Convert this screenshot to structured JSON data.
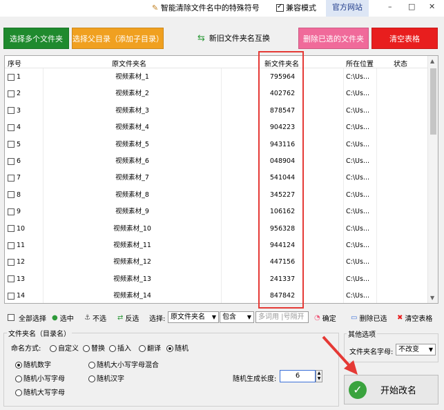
{
  "titlebar": {
    "tool_label": "智能清除文件名中的特殊符号",
    "compat_label": "兼容模式",
    "site_link": "官方网站",
    "minimize": "–",
    "maximize": "□",
    "close": "✕"
  },
  "toolbar": {
    "select_multi": "选择多个文件夹",
    "select_parent": "选择父目录（添加子目录）",
    "swap": "新旧文件夹名互换",
    "delete_selected": "删除已选的文件夹",
    "clear_table": "清空表格",
    "colors": {
      "green": "#1f8a2e",
      "orange": "#f0a020",
      "pink": "#f06a9a",
      "red": "#e81e1e"
    }
  },
  "table": {
    "headers": {
      "index": "序号",
      "original": "原文件夹名",
      "new": "新文件夹名",
      "location": "所在位置",
      "status": "状态"
    },
    "rows": [
      {
        "index": "1",
        "original": "视频素材_1",
        "new": "795964",
        "location": "C:\\Us...",
        "status": ""
      },
      {
        "index": "2",
        "original": "视频素材_2",
        "new": "402762",
        "location": "C:\\Us...",
        "status": ""
      },
      {
        "index": "3",
        "original": "视频素材_3",
        "new": "878547",
        "location": "C:\\Us...",
        "status": ""
      },
      {
        "index": "4",
        "original": "视频素材_4",
        "new": "904223",
        "location": "C:\\Us...",
        "status": ""
      },
      {
        "index": "5",
        "original": "视频素材_5",
        "new": "943116",
        "location": "C:\\Us...",
        "status": ""
      },
      {
        "index": "6",
        "original": "视频素材_6",
        "new": "048904",
        "location": "C:\\Us...",
        "status": ""
      },
      {
        "index": "7",
        "original": "视频素材_7",
        "new": "541044",
        "location": "C:\\Us...",
        "status": ""
      },
      {
        "index": "8",
        "original": "视频素材_8",
        "new": "345227",
        "location": "C:\\Us...",
        "status": ""
      },
      {
        "index": "9",
        "original": "视频素材_9",
        "new": "106162",
        "location": "C:\\Us...",
        "status": ""
      },
      {
        "index": "10",
        "original": "视频素材_10",
        "new": "956328",
        "location": "C:\\Us...",
        "status": ""
      },
      {
        "index": "11",
        "original": "视频素材_11",
        "new": "944124",
        "location": "C:\\Us...",
        "status": ""
      },
      {
        "index": "12",
        "original": "视频素材_12",
        "new": "447156",
        "location": "C:\\Us...",
        "status": ""
      },
      {
        "index": "13",
        "original": "视频素材_13",
        "new": "241337",
        "location": "C:\\Us...",
        "status": ""
      },
      {
        "index": "14",
        "original": "视频素材_14",
        "new": "847842",
        "location": "C:\\Us...",
        "status": ""
      }
    ]
  },
  "selectbar": {
    "select_all": "全部选择",
    "select": "选中",
    "deselect": "不选",
    "invert": "反选",
    "choose_label": "选择:",
    "field_value": "原文件夹名",
    "match_value": "包含",
    "keyword_placeholder": "多词用 |号隔开",
    "confirm": "确定",
    "delete_selected": "删除已选",
    "clear_table": "清空表格"
  },
  "name_group": {
    "title": "文件夹名（目录名）",
    "mode_label": "命名方式:",
    "modes": [
      "自定义",
      "替换",
      "插入",
      "翻译",
      "随机"
    ],
    "mode_selected": "随机",
    "random_options": [
      "随机数字",
      "随机大小写字母混合",
      "随机小写字母",
      "随机汉字",
      "随机大写字母"
    ],
    "random_selected": "随机数字",
    "length_label": "随机生成长度:",
    "length_value": "6"
  },
  "other_group": {
    "title": "其他选项",
    "case_label": "文件夹名字母:",
    "case_value": "不改变"
  },
  "start_button": "开始改名"
}
